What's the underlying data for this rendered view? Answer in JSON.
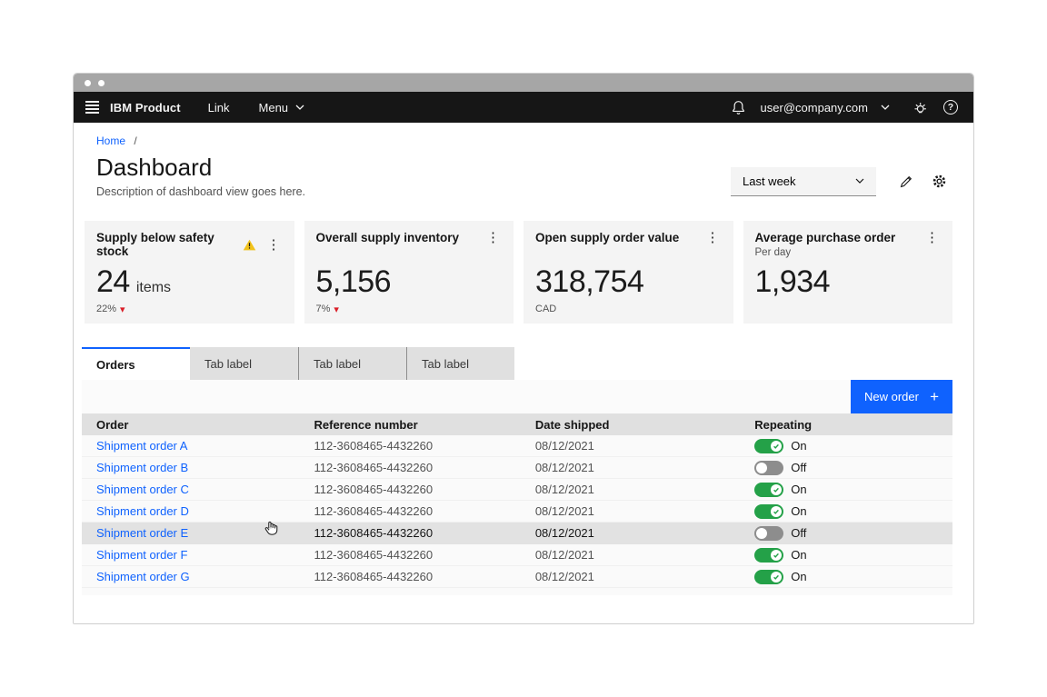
{
  "header": {
    "product_name": "IBM Product",
    "nav": [
      {
        "label": "Link"
      },
      {
        "label": "Menu"
      }
    ],
    "account_email": "user@company.com",
    "icons": [
      "hamburger-icon",
      "bell-icon",
      "chevron-down-icon",
      "light-icon",
      "help-icon"
    ]
  },
  "breadcrumb": {
    "home": "Home",
    "separator": "/"
  },
  "page": {
    "title": "Dashboard",
    "description": "Description of dashboard view goes here."
  },
  "controls": {
    "time_range_value": "Last week",
    "icons": [
      "edit-icon",
      "settings-icon"
    ]
  },
  "cards": [
    {
      "title": "Supply below safety stock",
      "value": "24",
      "suffix": "items",
      "delta": "22%",
      "trend": "down",
      "warning": true
    },
    {
      "title": "Overall supply inventory",
      "value": "5,156",
      "delta": "7%",
      "trend": "down"
    },
    {
      "title": "Open supply order value",
      "value": "318,754",
      "footnote": "CAD"
    },
    {
      "title": "Average purchase order",
      "subtitle": "Per day",
      "value": "1,934"
    }
  ],
  "tabs": [
    {
      "label": "Orders",
      "active": true
    },
    {
      "label": "Tab label",
      "active": false
    },
    {
      "label": "Tab label",
      "active": false
    },
    {
      "label": "Tab label",
      "active": false
    }
  ],
  "toolbar": {
    "primary_action_label": "New order",
    "plus_glyph": "+"
  },
  "table": {
    "columns": [
      "Order",
      "Reference number",
      "Date shipped",
      "Repeating"
    ],
    "rows": [
      {
        "order": "Shipment order A",
        "reference": "112-3608465-4432260",
        "date_shipped": "08/12/2021",
        "repeating": true,
        "toggle_label": "On",
        "hovered": false
      },
      {
        "order": "Shipment order B",
        "reference": "112-3608465-4432260",
        "date_shipped": "08/12/2021",
        "repeating": false,
        "toggle_label": "Off",
        "hovered": false
      },
      {
        "order": "Shipment order C",
        "reference": "112-3608465-4432260",
        "date_shipped": "08/12/2021",
        "repeating": true,
        "toggle_label": "On",
        "hovered": false
      },
      {
        "order": "Shipment order D",
        "reference": "112-3608465-4432260",
        "date_shipped": "08/12/2021",
        "repeating": true,
        "toggle_label": "On",
        "hovered": false
      },
      {
        "order": "Shipment order E",
        "reference": "112-3608465-4432260",
        "date_shipped": "08/12/2021",
        "repeating": false,
        "toggle_label": "Off",
        "hovered": true
      },
      {
        "order": "Shipment order F",
        "reference": "112-3608465-4432260",
        "date_shipped": "08/12/2021",
        "repeating": true,
        "toggle_label": "On",
        "hovered": false
      },
      {
        "order": "Shipment order G",
        "reference": "112-3608465-4432260",
        "date_shipped": "08/12/2021",
        "repeating": true,
        "toggle_label": "On",
        "hovered": false
      }
    ]
  },
  "colors": {
    "accent": "#0f62fe",
    "header_bg": "#161616",
    "link": "#0f62fe",
    "toggle_on": "#24a148",
    "toggle_off": "#8d8d8d",
    "warning": "#f1c21b",
    "negative": "#da1e28",
    "card_bg": "#f4f4f4",
    "table_header_bg": "#e0e0e0"
  }
}
